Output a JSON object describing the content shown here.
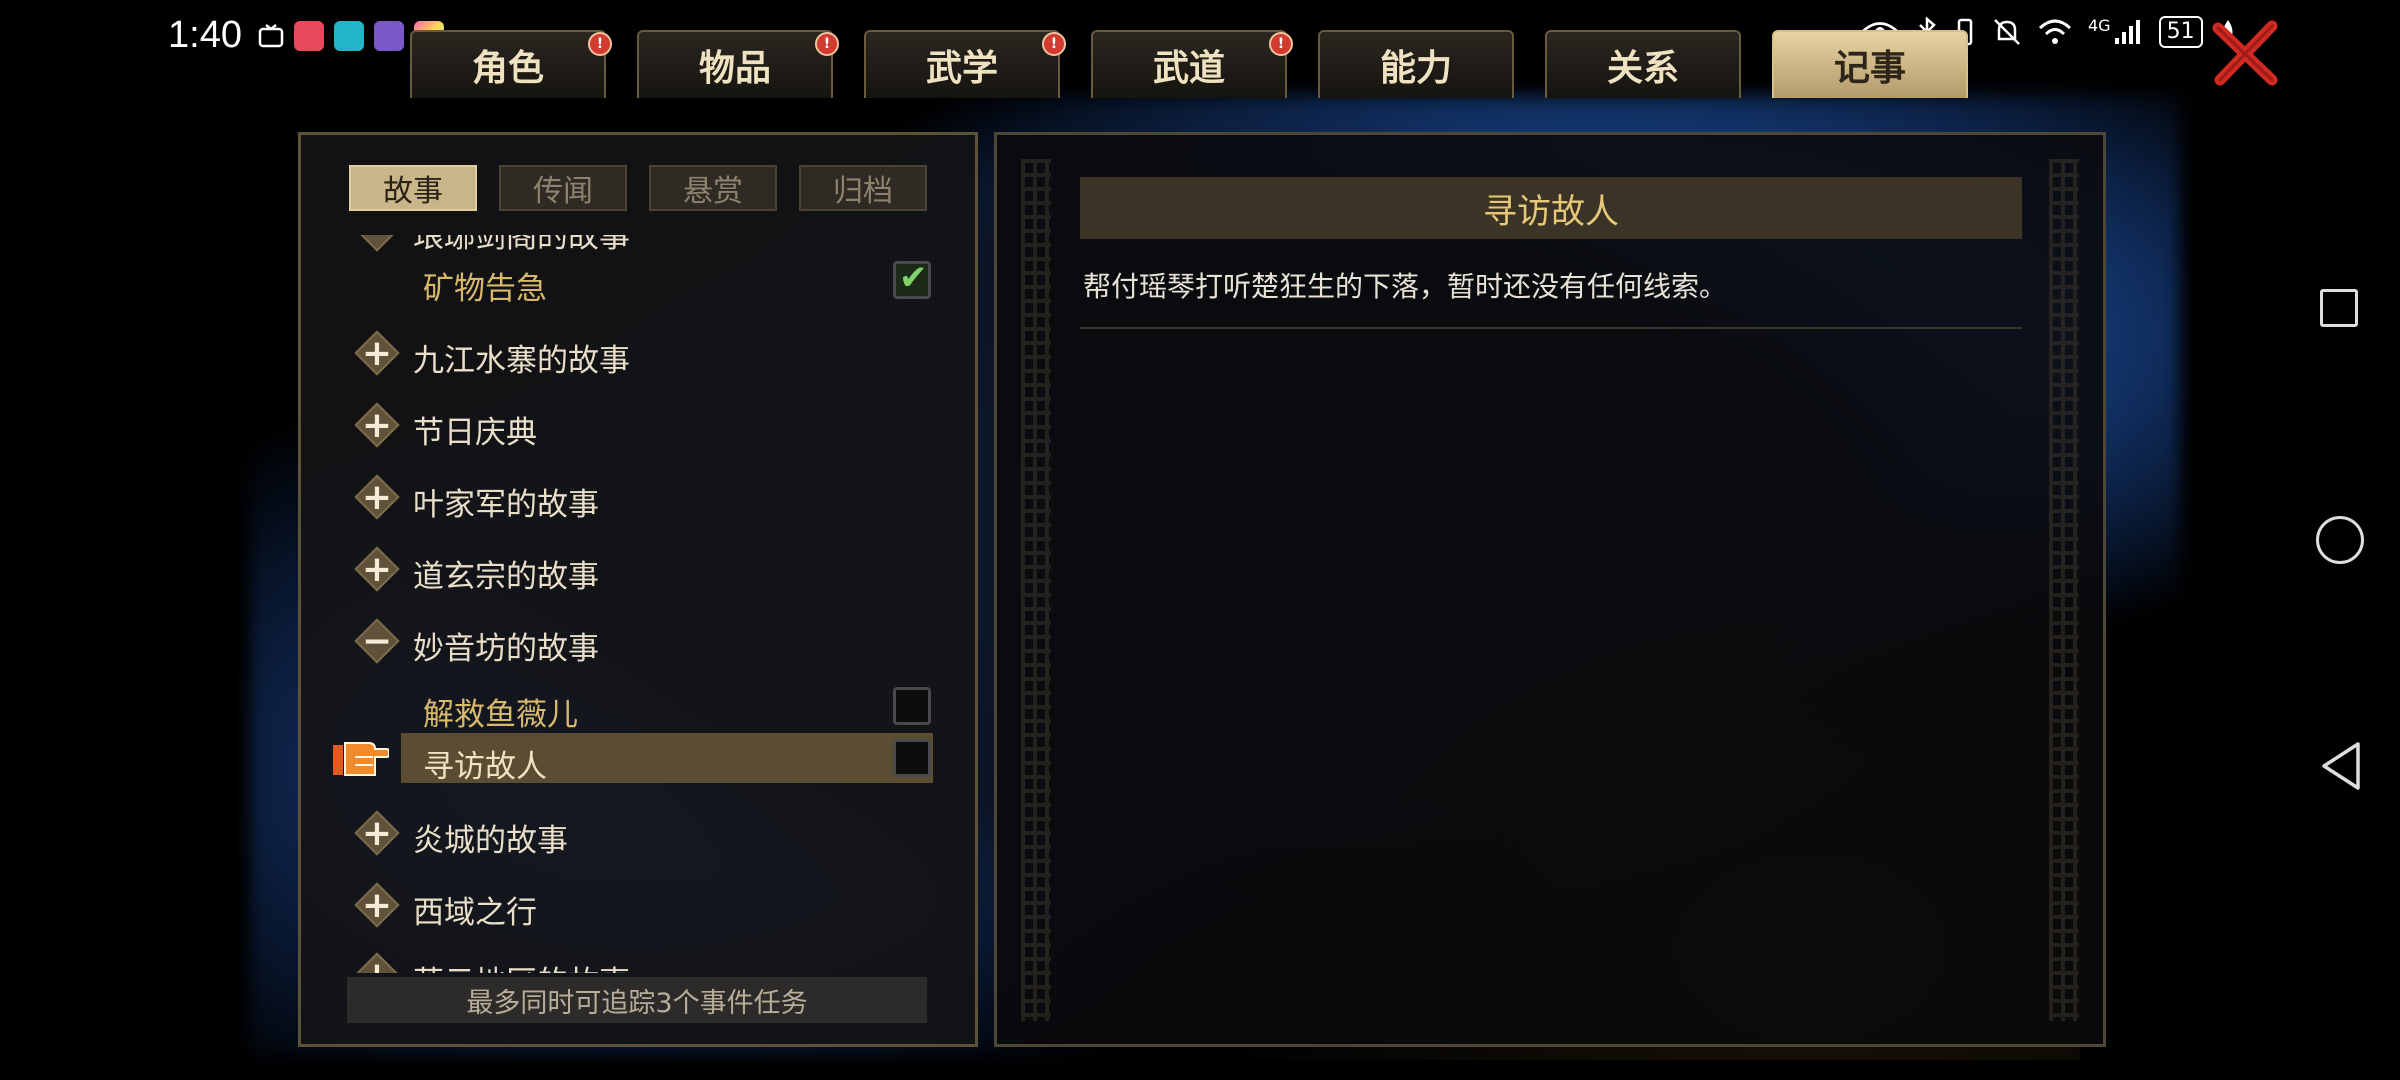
{
  "status_bar": {
    "time": "1:40",
    "more": "···",
    "network": "4G",
    "battery": "51"
  },
  "tabs": [
    {
      "label": "角色",
      "badge": true
    },
    {
      "label": "物品",
      "badge": true
    },
    {
      "label": "武学",
      "badge": true
    },
    {
      "label": "武道",
      "badge": true
    },
    {
      "label": "能力",
      "badge": false
    },
    {
      "label": "关系",
      "badge": false
    },
    {
      "label": "记事",
      "badge": false,
      "active": true
    }
  ],
  "subtabs": [
    "故事",
    "传闻",
    "悬赏",
    "归档"
  ],
  "list": {
    "partial_top": "琅琊剑阁的故事",
    "rows": [
      {
        "type": "sub",
        "label": "矿物告急",
        "checked": true
      },
      {
        "type": "group",
        "label": "九江水寨的故事",
        "expanded": false
      },
      {
        "type": "group",
        "label": "节日庆典",
        "expanded": false
      },
      {
        "type": "group",
        "label": "叶家军的故事",
        "expanded": false
      },
      {
        "type": "group",
        "label": "道玄宗的故事",
        "expanded": false
      },
      {
        "type": "group",
        "label": "妙音坊的故事",
        "expanded": true
      },
      {
        "type": "sub",
        "label": "解救鱼薇儿",
        "checked": false
      },
      {
        "type": "sub",
        "label": "寻访故人",
        "checked": false,
        "selected": true
      },
      {
        "type": "group",
        "label": "炎城的故事",
        "expanded": false
      },
      {
        "type": "group",
        "label": "西域之行",
        "expanded": false
      }
    ],
    "partial_bottom": "落云地区的故事"
  },
  "footer_note": "最多同时可追踪3个事件任务",
  "detail": {
    "title": "寻访故人",
    "description": "帮付瑶琴打听楚狂生的下落，暂时还没有任何线索。"
  },
  "colors": {
    "accent_gold": "#e7c878",
    "active_tab": "#c9b58a",
    "glow_blue": "#1d4f9b"
  }
}
